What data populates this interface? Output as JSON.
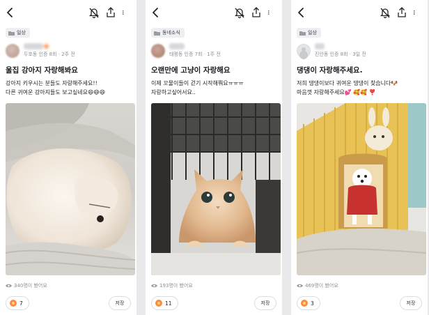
{
  "colors": {
    "accent": "#ff8a3d",
    "text": "#1a1c20",
    "meta": "#8b8e94",
    "chip_bg": "#eeeff2"
  },
  "posts": [
    {
      "category": "일상",
      "author_meta": "두호동 인증 8회 · 2주 전",
      "title": "울집 강아지 자랑해봐요",
      "body_lines": [
        "강아지 키우시는 분들도 자랑해주세요!!",
        "다른 귀여운 강아지들도 보고싶네요😄😄😄"
      ],
      "views": "340명이 봤어요",
      "likes": "7",
      "save_label": "저장",
      "photo_subject": "sleeping white pomeranian on blanket"
    },
    {
      "category": "동네소식",
      "author_meta": "태평동 인증 7회 · 1주 전",
      "title": "오랜만에 고냥이 자랑해요",
      "body_lines": [
        "이제 꼬물이들이 걷기 시작해쭤요ㅠㅠㅠ",
        "자랑하고싶어서요.."
      ],
      "views": "193명이 봤어요",
      "likes": "11",
      "save_label": "저장",
      "photo_subject": "orange tabby kitten in front of cage"
    },
    {
      "category": "일상",
      "author_meta": "진안동 인증 8회 · 3일 전",
      "title": "댕댕이 자랑해주세요.",
      "body_lines": [
        "저희 댕댕이보다 귀여운 댕댕이 찾습니다🐶",
        "마음껏 자랑해주세요💕 🥰🥰 ❣️"
      ],
      "views": "469명이 봤어요",
      "likes": "3",
      "save_label": "저장",
      "photo_subject": "white dog in red sweater inside yellow dog house"
    }
  ]
}
